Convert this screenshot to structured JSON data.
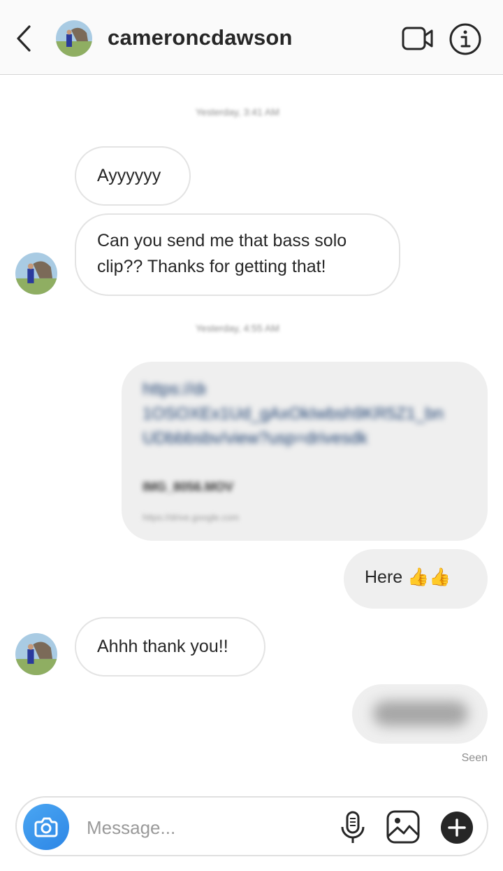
{
  "header": {
    "username": "cameroncdawson",
    "back_icon": "chevron-left-icon",
    "video_icon": "video-camera-icon",
    "info_icon": "info-icon"
  },
  "thread": {
    "timestamp_1": "Yesterday, 3:41 AM",
    "timestamp_2": "Yesterday, 4:55 AM",
    "messages": [
      {
        "from": "them",
        "text": "Ayyyyyy"
      },
      {
        "from": "them",
        "lines": [
          "Can you send me that bass solo",
          "clip?? Thanks for getting that!"
        ]
      },
      {
        "from": "me",
        "link_lines": [
          "https://drive.google.com/file/d/",
          "1OSOXEx1Ud_gAxOkIwbsh9KR5Z1_bn",
          "UDbbbsbv/view?usp=drivesdk"
        ],
        "preview_title": "IMG_8056.MOV",
        "preview_url": "https://drive.google.com"
      },
      {
        "from": "me",
        "text": "Here 👍👍"
      },
      {
        "from": "them",
        "text": "Ahhh thank you!!"
      },
      {
        "from": "me",
        "text": ""
      }
    ],
    "seen": "Seen"
  },
  "composer": {
    "placeholder": "Message...",
    "camera_icon": "camera-icon",
    "mic_icon": "microphone-icon",
    "gallery_icon": "gallery-icon",
    "plus_icon": "plus-icon"
  },
  "colors": {
    "camera_button": "#3897f0",
    "link_text": "#1b3e6f",
    "bubble_out": "#efefef",
    "bubble_in_border": "#e3e3e3"
  }
}
